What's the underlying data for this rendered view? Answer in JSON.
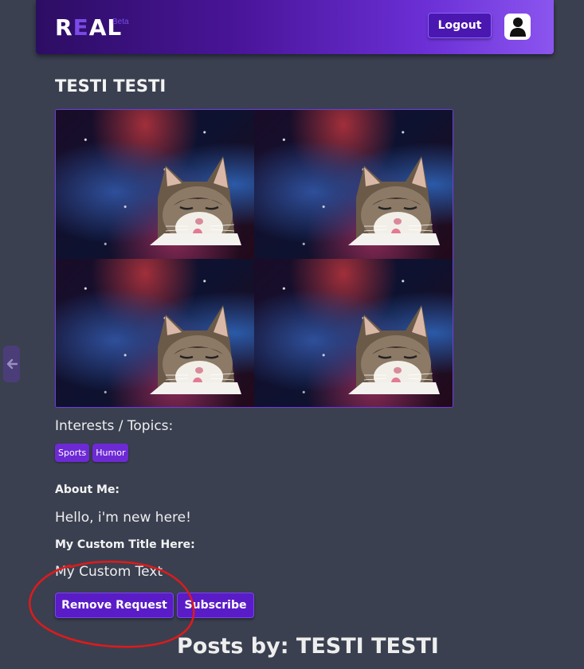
{
  "header": {
    "logo": {
      "prefix": "R",
      "accent": "E",
      "suffix": "AL"
    },
    "beta_label": "Beta",
    "logout_label": "Logout",
    "avatar_icon": "user-icon"
  },
  "sidebar_toggle": {
    "icon": "arrow-left-icon"
  },
  "profile": {
    "name": "TESTI TESTI",
    "banner_icon": "cat-space-image",
    "interests_label": "Interests / Topics:",
    "tags": [
      "Sports",
      "Humor"
    ],
    "about_heading": "About Me:",
    "about_text": "Hello, i'm new here!",
    "custom_title": "My Custom Title Here:",
    "custom_text": "My Custom Text",
    "remove_request_label": "Remove Request",
    "subscribe_label": "Subscribe"
  },
  "posts": {
    "heading": "Posts by: TESTI TESTI"
  },
  "colors": {
    "background": "#3a4050",
    "brand_purple": "#5a1cc7",
    "accent": "#7a4be6",
    "annotation_red": "#e01a1a"
  }
}
